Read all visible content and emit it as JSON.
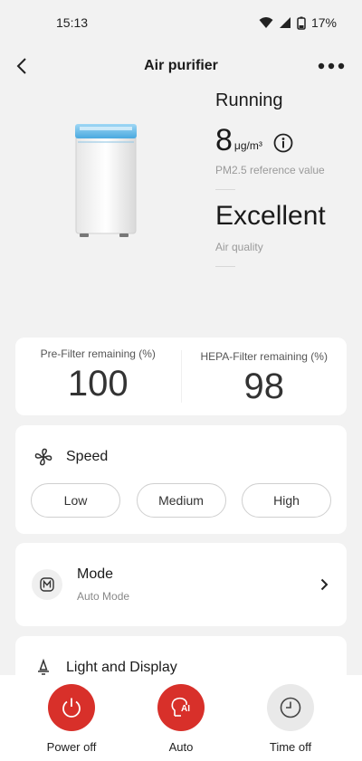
{
  "status_bar": {
    "time": "15:13",
    "battery": "17%"
  },
  "header": {
    "title": "Air purifier"
  },
  "hero": {
    "state": "Running",
    "pm_value": "8",
    "pm_unit": "μg/m³",
    "pm_caption": "PM2.5 reference value",
    "air_quality": "Excellent",
    "air_quality_caption": "Air quality"
  },
  "filters": {
    "pre": {
      "label": "Pre-Filter remaining (%)",
      "value": "100"
    },
    "hepa": {
      "label": "HEPA-Filter remaining (%)",
      "value": "98"
    }
  },
  "speed": {
    "label": "Speed",
    "options": [
      "Low",
      "Medium",
      "High"
    ]
  },
  "mode": {
    "label": "Mode",
    "value": "Auto Mode"
  },
  "light": {
    "label": "Light and Display"
  },
  "bottom": {
    "power_label": "Power off",
    "auto_label": "Auto",
    "timer_label": "Time off"
  },
  "colors": {
    "accent": "#d8302a",
    "background": "#f2f2f2",
    "device_glow": "#5bb8e8"
  }
}
